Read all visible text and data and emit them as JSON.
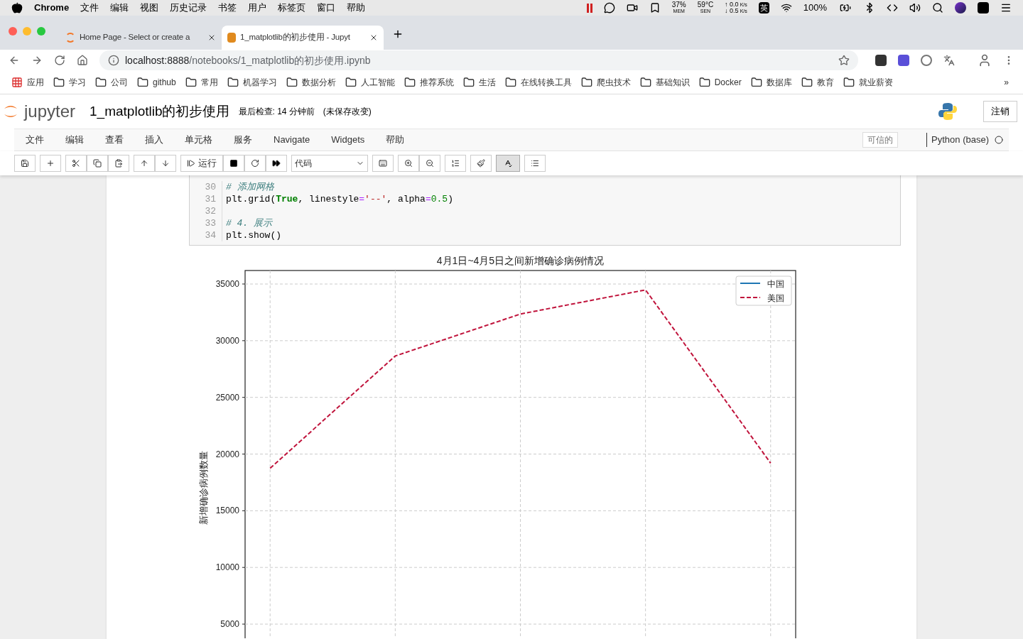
{
  "menubar": {
    "app": "Chrome",
    "items": [
      "文件",
      "编辑",
      "视图",
      "历史记录",
      "书签",
      "用户",
      "标签页",
      "窗口",
      "帮助"
    ],
    "mem": "37%",
    "mem_label": "MEM",
    "temp": "59°C",
    "temp_label": "SEN",
    "up": "↑ 0.0",
    "up_unit": "K/s",
    "down": "↓ 0.5",
    "down_unit": "K/s",
    "input_method": "英",
    "battery": "100%"
  },
  "tabs": [
    {
      "title": "Home Page - Select or create a",
      "selected": false
    },
    {
      "title": "1_matplotlib的初步使用 - Jupyt",
      "selected": true
    }
  ],
  "url": {
    "host": "localhost:8888",
    "path": "/notebooks/1_matplotlib的初步使用.ipynb"
  },
  "bookmarks": [
    {
      "kind": "apps",
      "label": "应用"
    },
    {
      "kind": "folder",
      "label": "学习"
    },
    {
      "kind": "folder",
      "label": "公司"
    },
    {
      "kind": "folder",
      "label": "github"
    },
    {
      "kind": "folder",
      "label": "常用"
    },
    {
      "kind": "folder",
      "label": "机器学习"
    },
    {
      "kind": "folder",
      "label": "数据分析"
    },
    {
      "kind": "folder",
      "label": "人工智能"
    },
    {
      "kind": "folder",
      "label": "推荐系统"
    },
    {
      "kind": "folder",
      "label": "生活"
    },
    {
      "kind": "folder",
      "label": "在线转换工具"
    },
    {
      "kind": "folder",
      "label": "爬虫技术"
    },
    {
      "kind": "folder",
      "label": "基础知识"
    },
    {
      "kind": "folder",
      "label": "Docker"
    },
    {
      "kind": "folder",
      "label": "数据库"
    },
    {
      "kind": "folder",
      "label": "教育"
    },
    {
      "kind": "folder",
      "label": "就业薪资"
    }
  ],
  "bookmarks_more": "»",
  "jupyter": {
    "logo_text": "jupyter",
    "notebook_name": "1_matplotlib的初步使用",
    "checkpoint": "最后检查: 14 分钟前",
    "unsaved": "(未保存改变)",
    "logout": "注销",
    "menu": [
      "文件",
      "编辑",
      "查看",
      "插入",
      "单元格",
      "服务",
      "Navigate",
      "Widgets",
      "帮助"
    ],
    "trusted": "可信的",
    "kernel": "Python (base)",
    "run": "运行",
    "cell_type": "代码"
  },
  "code": [
    {
      "n": "30",
      "tokens": [
        {
          "t": "# 添加网格",
          "kind": "comment"
        }
      ]
    },
    {
      "n": "31",
      "tokens": [
        {
          "t": "plt.grid(",
          "kind": "plain"
        },
        {
          "t": "True",
          "kind": "keyword"
        },
        {
          "t": ", linestyle",
          "kind": "plain"
        },
        {
          "t": "=",
          "kind": "operator"
        },
        {
          "t": "'--'",
          "kind": "string"
        },
        {
          "t": ", alpha",
          "kind": "plain"
        },
        {
          "t": "=",
          "kind": "operator"
        },
        {
          "t": "0.5",
          "kind": "number"
        },
        {
          "t": ")",
          "kind": "plain"
        }
      ]
    },
    {
      "n": "32"
    },
    {
      "n": "33",
      "tokens": [
        {
          "t": "# 4. 展示",
          "kind": "comment"
        }
      ]
    },
    {
      "n": "34",
      "tokens": [
        {
          "t": "plt.show()",
          "kind": "plain"
        }
      ]
    }
  ],
  "chart_data": {
    "type": "line",
    "title": "4月1日~4月5日之间新增确诊病例情况",
    "ylabel": "新增确诊病例数量",
    "categories": [
      null,
      null,
      null,
      null,
      null
    ],
    "grid": true,
    "ylim": [
      3750,
      36190
    ],
    "yticks": [
      5000,
      10000,
      15000,
      20000,
      25000,
      30000,
      35000
    ],
    "series": [
      {
        "name": "中国",
        "color": "#1f77b4",
        "line_style": "solid",
        "values": [
          null,
          null,
          null,
          null,
          null
        ]
      },
      {
        "name": "美国",
        "color": "#c0143c",
        "line_style": "dashed",
        "values": [
          18750,
          28650,
          32350,
          34480,
          19200
        ]
      }
    ]
  }
}
